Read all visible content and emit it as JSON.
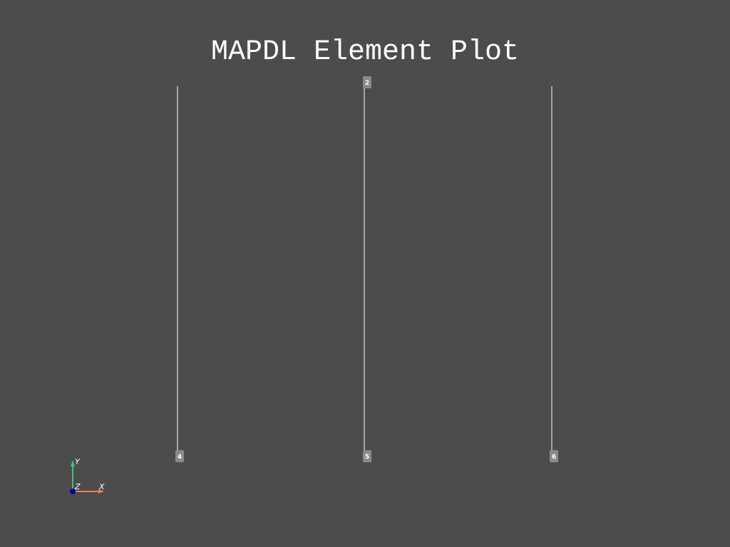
{
  "title": "MAPDL Element Plot",
  "colors": {
    "background": "#4c4c4c",
    "element_line": "#ffffff",
    "node_label_bg": "#8a8a8a",
    "axis_x": "#f08050",
    "axis_y": "#40c080",
    "axis_z": "#0000a0"
  },
  "node_labels": [
    "2",
    "4",
    "5",
    "6"
  ],
  "axes_widget": {
    "x_label": "X",
    "y_label": "Y",
    "z_label": "Z"
  }
}
